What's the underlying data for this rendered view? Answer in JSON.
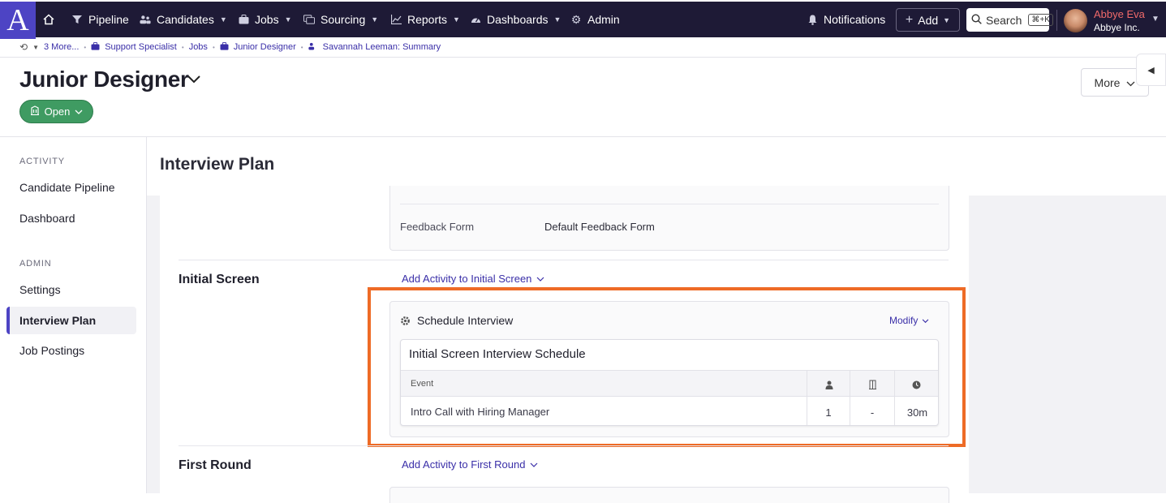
{
  "topnav": {
    "logo": "A",
    "items": [
      {
        "label": "Pipeline",
        "icon": "filter-icon"
      },
      {
        "label": "Candidates",
        "icon": "people-icon"
      },
      {
        "label": "Jobs",
        "icon": "briefcase-icon"
      },
      {
        "label": "Sourcing",
        "icon": "sourcing-icon"
      },
      {
        "label": "Reports",
        "icon": "chart-icon"
      },
      {
        "label": "Dashboards",
        "icon": "gauge-icon"
      },
      {
        "label": "Admin",
        "icon": "gear-icon"
      }
    ],
    "notifications": "Notifications",
    "add": "Add",
    "search": "Search",
    "search_kbd": "⌘+K",
    "user_name": "Abbye Eva",
    "user_org": "Abbye Inc."
  },
  "breadcrumbs": [
    "3 More...",
    "Support Specialist",
    "Jobs",
    "Junior Designer",
    "Savannah Leeman: Summary"
  ],
  "header": {
    "title": "Junior Designer",
    "status": "Open",
    "more": "More"
  },
  "sidebar": {
    "sections": [
      {
        "heading": "ACTIVITY",
        "items": [
          "Candidate Pipeline",
          "Dashboard"
        ]
      },
      {
        "heading": "ADMIN",
        "items": [
          "Settings",
          "Interview Plan",
          "Job Postings"
        ]
      }
    ],
    "active": "Interview Plan"
  },
  "main": {
    "title": "Interview Plan",
    "feedback_label": "Feedback Form",
    "feedback_value": "Default Feedback Form",
    "stages": [
      {
        "name": "Initial Screen",
        "add_label": "Add Activity to Initial Screen"
      },
      {
        "name": "First Round",
        "add_label": "Add Activity to First Round"
      }
    ],
    "activity": {
      "title": "Schedule Interview",
      "modify": "Modify",
      "schedule_title": "Initial Screen Interview Schedule",
      "table": {
        "header": "Event",
        "rows": [
          {
            "event": "Intro Call with Hiring Manager",
            "interviewers": "1",
            "room": "-",
            "duration": "30m"
          }
        ]
      }
    }
  },
  "colors": {
    "nav_bg": "#1e1a36",
    "brand": "#4d44c4",
    "link": "#3a2fa8",
    "status_green": "#3f9b62",
    "highlight": "#ee6b26"
  }
}
